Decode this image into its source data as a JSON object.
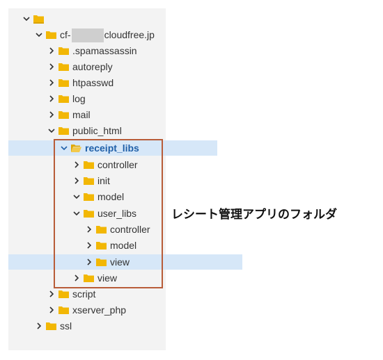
{
  "tree": {
    "root": {
      "label": "",
      "underline_color": "#d9a300"
    },
    "domain": {
      "prefix": "cf-",
      "suffix": "cloudfree.jp"
    },
    "items": {
      "spamassassin": ".spamassassin",
      "autoreply": "autoreply",
      "htpasswd": "htpasswd",
      "log": "log",
      "mail": "mail",
      "public_html": "public_html",
      "receipt_libs": "receipt_libs",
      "rl_controller": "controller",
      "rl_init": "init",
      "rl_model": "model",
      "rl_user_libs": "user_libs",
      "ul_controller": "controller",
      "ul_model": "model",
      "ul_view": "view",
      "rl_view": "view",
      "script": "script",
      "xserver_php": "xserver_php",
      "ssl": "ssl"
    }
  },
  "annotation": {
    "text": "レシート管理アプリのフォルダ",
    "box_color": "#b85c38"
  },
  "colors": {
    "folder": "#f2b705",
    "folder_open": "#f2c94c",
    "selected_bg": "#d6e7f8",
    "selected_text": "#1f5fa8"
  },
  "icons": {
    "collapsed": "chevron-right-icon",
    "expanded": "chevron-down-icon",
    "folder": "folder-icon",
    "folder_open": "folder-open-icon"
  }
}
